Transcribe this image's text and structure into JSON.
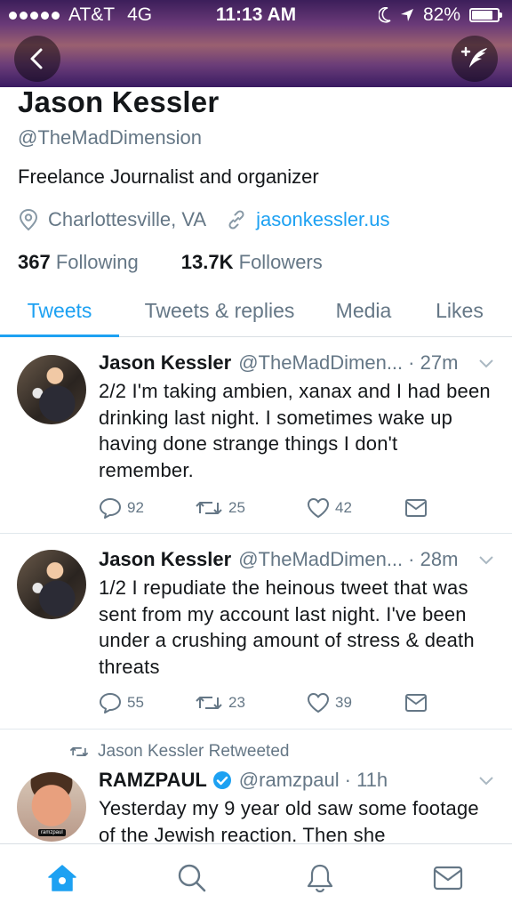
{
  "status_bar": {
    "carrier": "AT&T",
    "network": "4G",
    "time": "11:13 AM",
    "battery": "82%",
    "battery_level": 0.82
  },
  "profile": {
    "name": "Jason Kessler",
    "handle": "@TheMadDimension",
    "bio": "Freelance Journalist and organizer",
    "location": "Charlottesville, VA",
    "website": "jasonkessler.us",
    "following_count": "367",
    "following_label": "Following",
    "followers_count": "13.7K",
    "followers_label": "Followers"
  },
  "tabs": [
    {
      "label": "Tweets",
      "active": true
    },
    {
      "label": "Tweets & replies",
      "active": false
    },
    {
      "label": "Media",
      "active": false
    },
    {
      "label": "Likes",
      "active": false
    }
  ],
  "tweets": [
    {
      "name": "Jason Kessler",
      "handle": "@TheMadDimen...",
      "time": "· 27m",
      "text": "2/2 I'm taking ambien, xanax and I had been drinking last night. I sometimes wake up having done strange things I don't remember.",
      "replies": "92",
      "retweets": "25",
      "likes": "42"
    },
    {
      "name": "Jason Kessler",
      "handle": "@TheMadDimen...",
      "time": "· 28m",
      "text": "1/2  I repudiate the heinous tweet that was sent from my account last night. I've been under a crushing amount of stress & death threats",
      "replies": "55",
      "retweets": "23",
      "likes": "39"
    },
    {
      "retweeted_by": "Jason Kessler Retweeted",
      "name": "RAMZPAUL",
      "handle": "@ramzpaul",
      "time": "· 11h",
      "text": "Yesterday my 9 year old saw some footage of the Jewish reaction. Then she",
      "avatar_tag": "ramzpaul"
    }
  ],
  "colors": {
    "accent": "#1da1f2",
    "muted": "#657786",
    "text": "#14171a"
  },
  "icons": [
    "back-arrow-icon",
    "compose-icon",
    "location-icon",
    "link-icon",
    "reply-icon",
    "retweet-icon",
    "like-icon",
    "dm-icon",
    "chevron-down-icon",
    "verified-icon",
    "home-icon",
    "search-icon",
    "notifications-icon",
    "messages-icon"
  ]
}
